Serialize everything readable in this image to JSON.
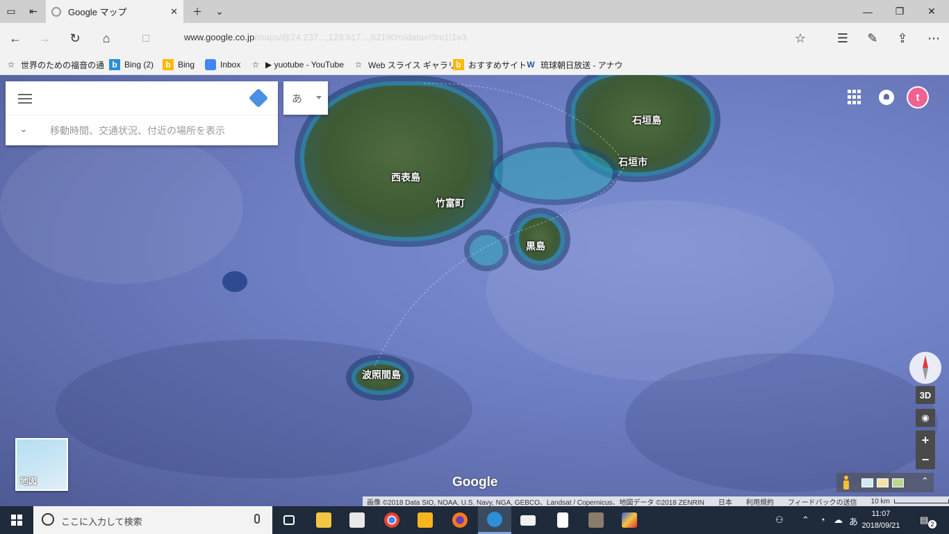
{
  "browser": {
    "tab_title": "Google マップ",
    "url_host": "www.google.co.jp",
    "url_rest": "/maps/@24.237...,123.917...,62190m/data=!3m1!1e3"
  },
  "favorites": [
    {
      "label": "世界のための福音の通",
      "icon": "star-icon"
    },
    {
      "label": "Bing (2)",
      "icon": "bing-icon"
    },
    {
      "label": "Bing",
      "icon": "bing-icon"
    },
    {
      "label": "Inbox",
      "icon": "inbox-icon"
    },
    {
      "label": "▶ yuotube - YouTube",
      "icon": "star-icon"
    },
    {
      "label": "Web スライス ギャラリー",
      "icon": "star-icon"
    },
    {
      "label": "おすすめサイト",
      "icon": "bing-icon"
    },
    {
      "label": "琉球朝日放送 - アナウ",
      "icon": "word-icon"
    }
  ],
  "search": {
    "hint": "移動時間、交通状況、付近の場所を表示",
    "ime_label": "あ"
  },
  "map": {
    "labels": {
      "iriomote": "西表島",
      "taketomi": "竹富町",
      "ishigaki_island": "石垣島",
      "ishigaki_city": "石垣市",
      "kuroshima": "黒島",
      "hateruma": "波照間島"
    },
    "thumbnail_label": "地図",
    "logo": "Google",
    "controls": {
      "threed": "3D",
      "zoom_in": "+",
      "zoom_out": "−"
    },
    "avatar_letter": "t",
    "footer": {
      "attribution": "画像 ©2018 Data SIO, NOAA, U.S. Navy, NGA, GEBCO、Landsat / Copernicus、地図データ ©2018 ZENRIN",
      "country": "日本",
      "terms": "利用規約",
      "feedback": "フィードバックの送信",
      "scale": "10 km"
    }
  },
  "taskbar": {
    "search_placeholder": "ここに入力して検索",
    "clock_time": "11:07",
    "clock_date": "2018/09/21",
    "ime": "あ",
    "notification_count": "2"
  }
}
